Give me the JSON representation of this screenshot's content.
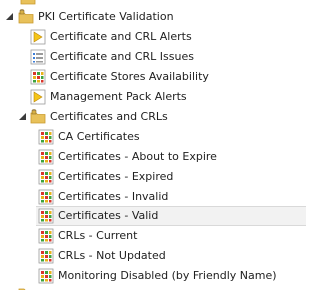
{
  "tree": {
    "top_partial": {
      "label": "…",
      "icon": "folder-icon"
    },
    "group_pki": {
      "label": "PKI Certificate Validation",
      "expanded": true,
      "icon": "locked-folder-icon",
      "children": [
        {
          "label": "Certificate and CRL Alerts",
          "icon": "alert-view-icon"
        },
        {
          "label": "Certificate and CRL Issues",
          "icon": "state-view-icon"
        },
        {
          "label": "Certificate Stores Availability",
          "icon": "health-grid-icon"
        },
        {
          "label": "Management Pack Alerts",
          "icon": "alert-view-icon"
        }
      ]
    },
    "group_certs": {
      "label": "Certificates and CRLs",
      "expanded": true,
      "icon": "locked-folder-icon",
      "children": [
        {
          "label": "CA Certificates",
          "icon": "state-grid-icon"
        },
        {
          "label": "Certificates - About to Expire",
          "icon": "state-grid-icon"
        },
        {
          "label": "Certificates - Expired",
          "icon": "state-grid-icon"
        },
        {
          "label": "Certificates - Invalid",
          "icon": "state-grid-icon"
        },
        {
          "label": "Certificates - Valid",
          "icon": "state-grid-icon",
          "selected": true
        },
        {
          "label": "CRLs - Current",
          "icon": "state-grid-icon"
        },
        {
          "label": "CRLs - Not Updated",
          "icon": "state-grid-icon"
        },
        {
          "label": "Monitoring Disabled (by Friendly Name)",
          "icon": "state-grid-icon"
        }
      ]
    },
    "bottom_partial": {
      "icon": "folder-icon"
    }
  },
  "colors": {
    "folder": "#e8c15a",
    "folder_dark": "#c99a2e",
    "lock": "#8a6d2a",
    "alert_yellow": "#f5c518",
    "grid_red": "#d9342b",
    "grid_green": "#3da33d",
    "grid_yellow": "#e8b21a",
    "selection_bg": "#f2f2f2"
  }
}
